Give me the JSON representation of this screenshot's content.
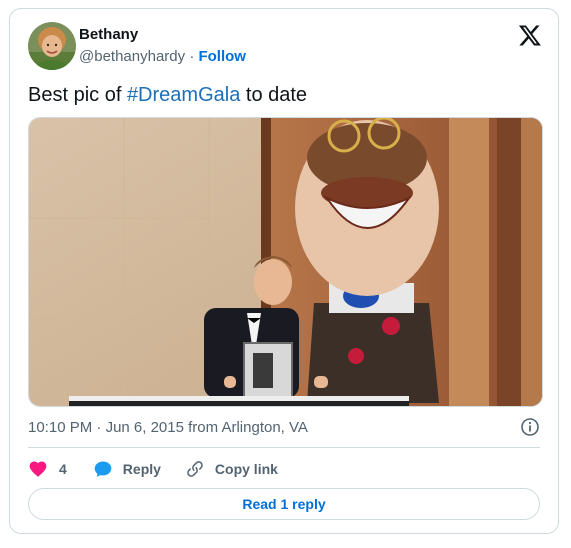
{
  "author": {
    "display_name": "Bethany",
    "handle": "@bethanyhardy",
    "separator": "·",
    "follow_label": "Follow",
    "avatar_icon": "avatar-photo"
  },
  "brand": {
    "logo_icon": "x-logo-icon"
  },
  "tweet": {
    "text_before": "Best pic of ",
    "hashtag": "#DreamGala",
    "text_after": " to date"
  },
  "media": {
    "icon": "photo",
    "description_icon": "pianist-with-mascot-photo"
  },
  "meta": {
    "time": "10:10 PM",
    "date_location": "Jun 6, 2015 from Arlington, VA",
    "dot": "·",
    "info_icon": "info-icon"
  },
  "actions": {
    "like_count": "4",
    "reply_label": "Reply",
    "copy_label": "Copy link"
  },
  "read_replies_label": "Read 1 reply",
  "colors": {
    "like": "#f91880",
    "reply": "#1d9bf0",
    "link": "#006fd6",
    "text": "#0f1419",
    "muted": "#536471",
    "border": "#cfd9de"
  }
}
